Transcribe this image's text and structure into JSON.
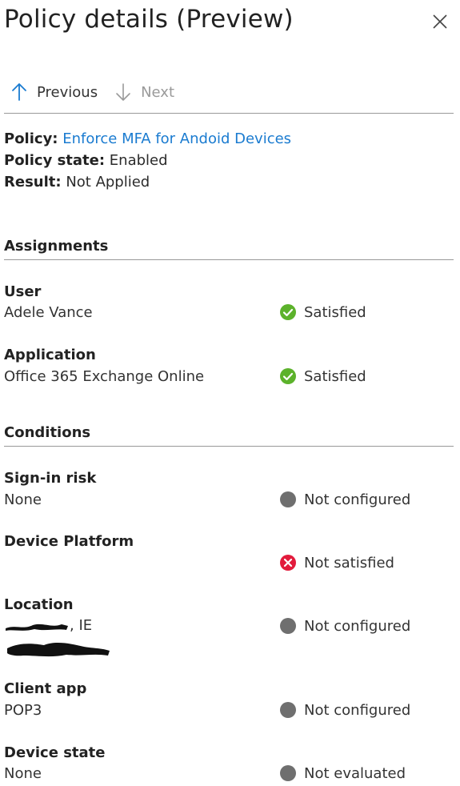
{
  "header": {
    "title": "Policy details (Preview)",
    "close_icon": "close-icon"
  },
  "nav": {
    "previous": "Previous",
    "next": "Next"
  },
  "summary": {
    "policy_label": "Policy:",
    "policy_value": "Enforce MFA for Andoid Devices",
    "state_label": "Policy state:",
    "state_value": "Enabled",
    "result_label": "Result:",
    "result_value": "Not Applied"
  },
  "assignments": {
    "title": "Assignments",
    "rows": [
      {
        "label": "User",
        "value": "Adele Vance",
        "status": "Satisfied",
        "status_icon": "check-circle-icon"
      },
      {
        "label": "Application",
        "value": "Office 365 Exchange Online",
        "status": "Satisfied",
        "status_icon": "check-circle-icon"
      }
    ]
  },
  "conditions": {
    "title": "Conditions",
    "rows": [
      {
        "label": "Sign-in risk",
        "value": "None",
        "status": "Not configured",
        "status_icon": "gray-dot-icon"
      },
      {
        "label": "Device Platform",
        "value": "",
        "status": "Not satisfied",
        "status_icon": "error-circle-icon"
      },
      {
        "label": "Location",
        "value": ", IE",
        "status": "Not configured",
        "status_icon": "gray-dot-icon"
      },
      {
        "label": "Client app",
        "value": "POP3",
        "status": "Not configured",
        "status_icon": "gray-dot-icon"
      },
      {
        "label": "Device state",
        "value": "None",
        "status": "Not evaluated",
        "status_icon": "gray-dot-icon"
      }
    ]
  },
  "colors": {
    "link": "#1a7bd0",
    "success": "#5cb22b",
    "error": "#e21b3c",
    "neutral": "#6f6f6f",
    "divider": "#999999"
  }
}
